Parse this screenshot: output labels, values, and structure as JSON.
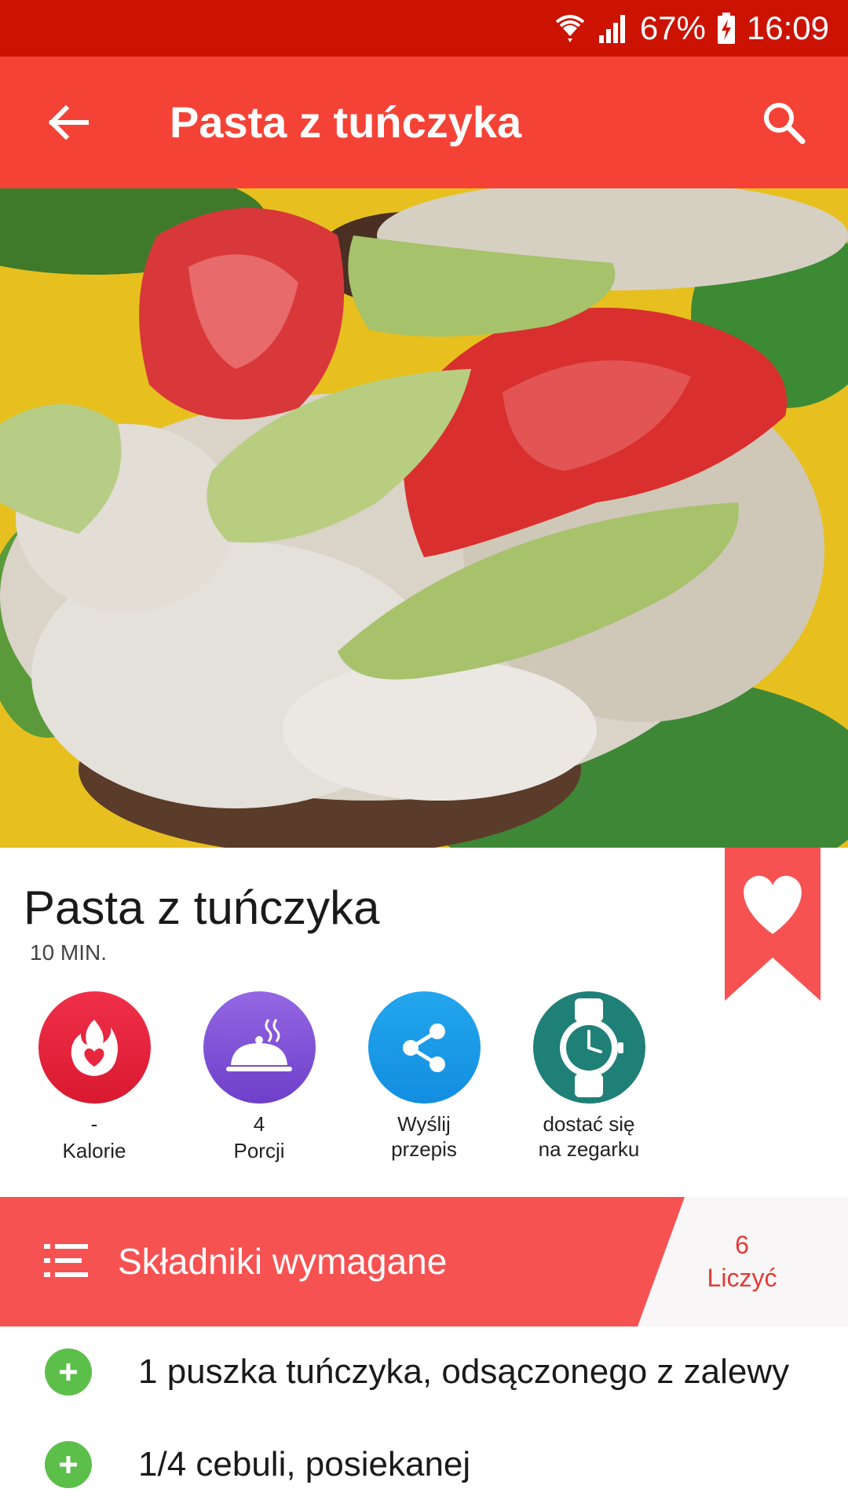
{
  "status_bar": {
    "battery": "67%",
    "time": "16:09"
  },
  "app_bar": {
    "title": "Pasta z tuńczyka"
  },
  "recipe": {
    "title": "Pasta z tuńczyka",
    "time": "10 MIN."
  },
  "actions": [
    {
      "line1": "-",
      "line2": "Kalorie",
      "icon": "flame-heart-icon",
      "color": "#e8273f"
    },
    {
      "line1": "4",
      "line2": "Porcji",
      "icon": "serving-cloche-icon",
      "color": "#7e4fd6"
    },
    {
      "line1": "Wyślij",
      "line2": "przepis",
      "icon": "share-icon",
      "color": "#1e9be8"
    },
    {
      "line1": "dostać się",
      "line2": "na zegarku",
      "icon": "watch-icon",
      "color": "#1f8078"
    }
  ],
  "ingredients_header": {
    "label": "Składniki wymagane",
    "count": "6",
    "count_label": "Liczyć"
  },
  "ingredients": [
    "1 puszka tuńczyka, odsączonego z zalewy",
    "1/4 cebuli, posiekanej"
  ],
  "colors": {
    "status_bar": "#cc1200",
    "app_bar": "#f44336",
    "accent": "#f75252",
    "add": "#5cbf4a"
  }
}
